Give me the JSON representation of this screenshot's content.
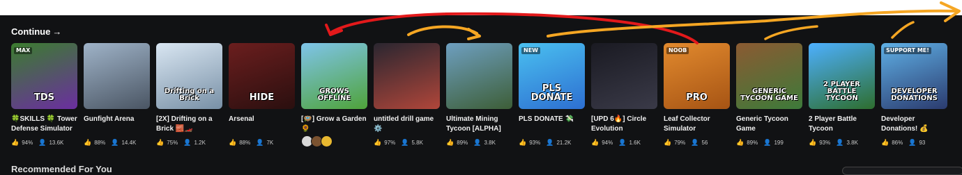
{
  "section": {
    "title": "Continue",
    "arrow": "→"
  },
  "recommended": {
    "title": "Recommended For You"
  },
  "stat_icons": {
    "like": "thumbs-up-icon",
    "players": "person-icon"
  },
  "games": [
    {
      "name": "🍀SKILLS 🍀 Tower Defense Simulator",
      "rating": "94%",
      "players": "13.6K",
      "colors": [
        "#3b7d2e",
        "#6b2ea0"
      ],
      "tag": "TDS",
      "tag2": "MAX"
    },
    {
      "name": "Gunfight Arena",
      "rating": "88%",
      "players": "14.4K",
      "colors": [
        "#9fb3c8",
        "#4a5563"
      ],
      "tag": ""
    },
    {
      "name": "[2X] Drifting on a Brick 🧱🏎️",
      "rating": "75%",
      "players": "1.2K",
      "colors": [
        "#d9e6f2",
        "#7890a6"
      ],
      "tag": "Drifting on a Brick"
    },
    {
      "name": "Arsenal",
      "rating": "88%",
      "players": "7K",
      "colors": [
        "#6b1e1e",
        "#2a0f0f"
      ],
      "tag": "HIDE"
    },
    {
      "name": "[🪺] Grow a Garden 🌻",
      "rating": "",
      "players": "",
      "colors": [
        "#7fc4ea",
        "#4fa33a"
      ],
      "tag": "GROWS OFFLINE"
    },
    {
      "name": "untitled drill game ⚙️",
      "rating": "97%",
      "players": "5.8K",
      "colors": [
        "#2a2630",
        "#b0463a"
      ],
      "tag": ""
    },
    {
      "name": "Ultimate Mining Tycoon [ALPHA]",
      "rating": "89%",
      "players": "3.8K",
      "colors": [
        "#6e9fc0",
        "#3d5e37"
      ],
      "tag": ""
    },
    {
      "name": "PLS DONATE 💸",
      "rating": "93%",
      "players": "21.2K",
      "colors": [
        "#4ac0f0",
        "#2d6fd1"
      ],
      "tag": "PLS DONATE",
      "tag2": "NEW"
    },
    {
      "name": "[UPD 6🔥] Circle Evolution",
      "rating": "94%",
      "players": "1.6K",
      "colors": [
        "#1a1a22",
        "#3a3a48"
      ],
      "tag": ""
    },
    {
      "name": "Leaf Collector Simulator",
      "rating": "79%",
      "players": "56",
      "colors": [
        "#e28a2e",
        "#a65414"
      ],
      "tag": "PRO",
      "tag2": "NOOB"
    },
    {
      "name": "Generic Tycoon Game",
      "rating": "89%",
      "players": "199",
      "colors": [
        "#8b5a32",
        "#3d7a3a"
      ],
      "tag": "GENERIC TYCOON GAME"
    },
    {
      "name": "2 Player Battle Tycoon",
      "rating": "93%",
      "players": "3.8K",
      "colors": [
        "#4db0ff",
        "#2e6e2e"
      ],
      "tag": "2 PLAYER BATTLE TYCOON"
    },
    {
      "name": "Developer Donations! 💰",
      "rating": "86%",
      "players": "93",
      "colors": [
        "#5fb0e6",
        "#2b3b6e"
      ],
      "tag": "DEVELOPER DONATIONS",
      "tag2": "SUPPORT ME!"
    }
  ],
  "friend_avatars": [
    "#d9d9d9",
    "#7a5230",
    "#e8b830"
  ]
}
